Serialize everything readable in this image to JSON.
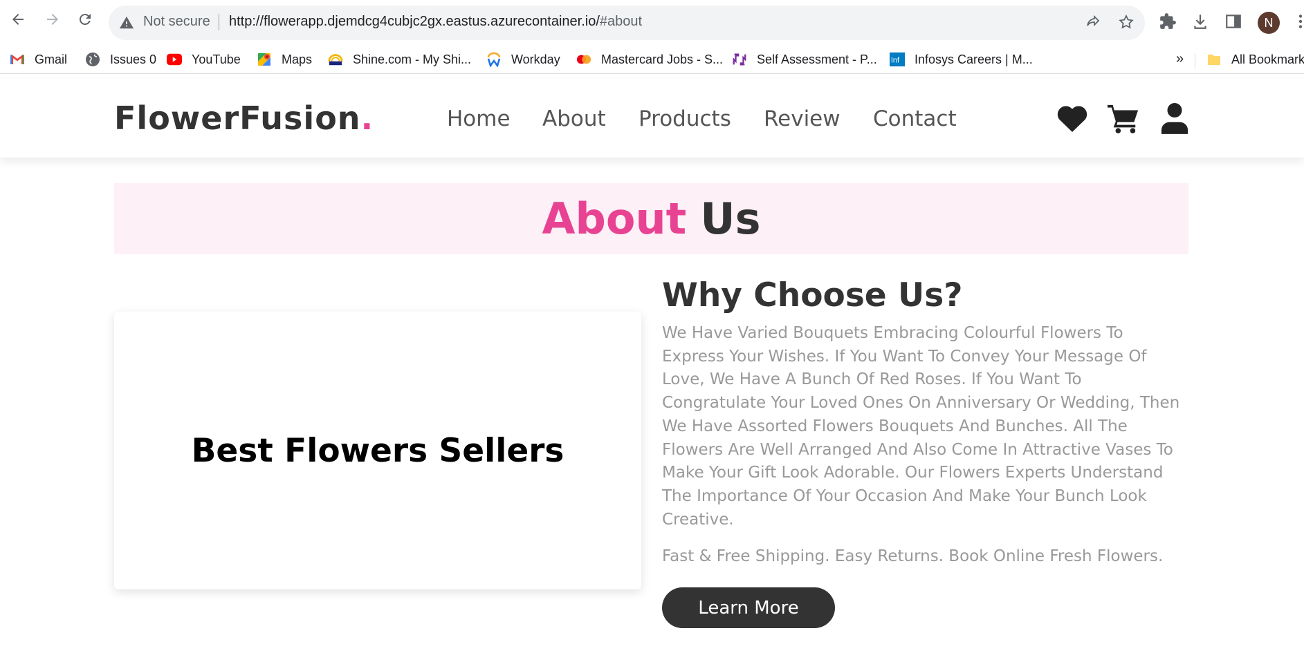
{
  "browser": {
    "security_label": "Not secure",
    "url_host": "http://flowerapp.djemdcg4cubjc2gx.eastus.azurecontainer.io/",
    "url_hash": "#about",
    "profile_initial": "N",
    "icons": [
      "back-icon",
      "forward-icon",
      "reload-icon",
      "warning-icon",
      "share-icon",
      "star-icon",
      "extensions-icon",
      "download-icon",
      "side-panel-icon",
      "overflow-icon"
    ]
  },
  "bookmarks": {
    "items": [
      {
        "label": "Gmail",
        "icon": "gmail-icon"
      },
      {
        "label": "Issues 0",
        "icon": "globe-icon"
      },
      {
        "label": "YouTube",
        "icon": "youtube-icon"
      },
      {
        "label": "Maps",
        "icon": "maps-icon"
      },
      {
        "label": "Shine.com - My Shi...",
        "icon": "shine-icon"
      },
      {
        "label": "Workday",
        "icon": "workday-icon"
      },
      {
        "label": "Mastercard Jobs - S...",
        "icon": "mastercard-icon"
      },
      {
        "label": "Self Assessment - P...",
        "icon": "assessment-icon"
      },
      {
        "label": "Infosys Careers | M...",
        "icon": "infosys-icon"
      }
    ],
    "more": "»",
    "all_bookmarks": "All Bookmarks"
  },
  "site": {
    "logo_text": "FlowerFusion",
    "logo_dot": ".",
    "nav": [
      "Home",
      "About",
      "Products",
      "Review",
      "Contact"
    ],
    "header_icons": [
      "heart-icon",
      "cart-icon",
      "user-icon"
    ]
  },
  "about": {
    "heading_accent": "About",
    "heading_rest": "Us",
    "video_caption": "Best Flowers Sellers",
    "title": "Why Choose Us?",
    "body": "We Have Varied Bouquets Embracing Colourful Flowers To Express Your Wishes. If You Want To Convey Your Message Of Love, We Have A Bunch Of Red Roses. If You Want To Congratulate Your Loved Ones On Anniversary Or Wedding, Then We Have Assorted Flowers Bouquets And Bunches. All The Flowers Are Well Arranged And Also Come In Attractive Vases To Make Your Gift Look Adorable. Our Flowers Experts Understand The Importance Of Your Occasion And Make Your Bunch Look Creative.",
    "extra": "Fast & Free Shipping. Easy Returns. Book Online Fresh Flowers.",
    "button_label": "Learn More"
  },
  "colors": {
    "accent": "#e84393",
    "text_dark": "#333333",
    "text_muted": "#999999",
    "heading_band": "#fdf0f6"
  }
}
